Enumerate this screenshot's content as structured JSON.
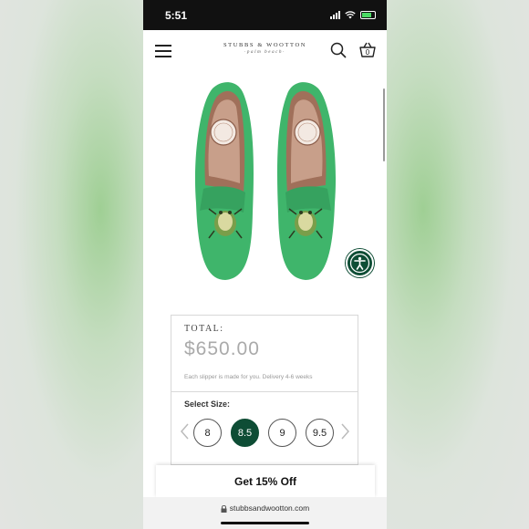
{
  "status_bar": {
    "time": "5:51"
  },
  "header": {
    "brand_name": "STUBBS & WOOTTON",
    "brand_sub": "·palm beach·",
    "cart_count": "0",
    "icons": [
      "menu-icon",
      "search-icon",
      "basket-icon"
    ]
  },
  "product": {
    "image_alt": "green-frog-slippers",
    "colors": {
      "slipper_green": "#3fb56b",
      "accent_dark_green": "#0e4d35"
    }
  },
  "pricing": {
    "total_label": "TOTAL:",
    "price": "$650.00",
    "note": "Each slipper is made for you. Delivery 4-6 weeks"
  },
  "sizes": {
    "label": "Select Size:",
    "options": [
      "8",
      "8.5",
      "9",
      "9.5"
    ],
    "selected": "8.5"
  },
  "promo": {
    "label": "Get 15% Off"
  },
  "browser": {
    "url": "stubbsandwootton.com"
  }
}
